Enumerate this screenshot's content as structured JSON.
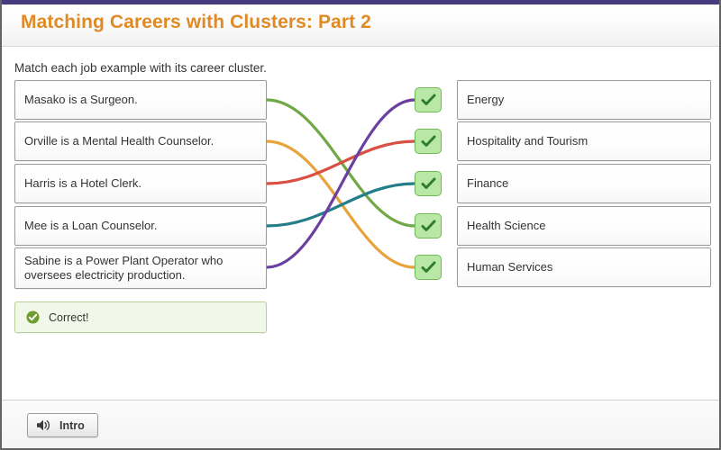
{
  "header": {
    "title": "Matching Careers with Clusters: Part 2",
    "title_color": "#e08a26",
    "accent_bar_color": "#473a7e"
  },
  "instruction": "Match each job example with its career cluster.",
  "prompts": [
    {
      "label": "Masako is a Surgeon.",
      "line_color": "#70a845"
    },
    {
      "label": "Orville is a Mental Health Counselor.",
      "line_color": "#e8a33d"
    },
    {
      "label": "Harris is a Hotel Clerk.",
      "line_color": "#d94f42"
    },
    {
      "label": "Mee is a Loan Counselor.",
      "line_color": "#247d8b"
    },
    {
      "label": "Sabine is a Power Plant Operator who oversees electricity production.",
      "line_color": "#6b3fa0"
    }
  ],
  "targets": [
    {
      "label": "Energy"
    },
    {
      "label": "Hospitality and Tourism"
    },
    {
      "label": "Finance"
    },
    {
      "label": "Health Science"
    },
    {
      "label": "Human Services"
    }
  ],
  "check_marks": [
    {
      "state": "correct"
    },
    {
      "state": "correct"
    },
    {
      "state": "correct"
    },
    {
      "state": "correct"
    },
    {
      "state": "correct"
    }
  ],
  "connections": [
    {
      "from": "Masako is a Surgeon.",
      "to": "Health Science",
      "color": "#70a845"
    },
    {
      "from": "Orville is a Mental Health Counselor.",
      "to": "Human Services",
      "color": "#e8a33d"
    },
    {
      "from": "Harris is a Hotel Clerk.",
      "to": "Hospitality and Tourism",
      "color": "#d94f42"
    },
    {
      "from": "Mee is a Loan Counselor.",
      "to": "Finance",
      "color": "#247d8b"
    },
    {
      "from": "Sabine is a Power Plant Operator who oversees electricity production.",
      "to": "Energy",
      "color": "#6b3fa0"
    }
  ],
  "feedback": {
    "text": "Correct!",
    "icon": "check-circle-icon",
    "background": "#f2f8e9",
    "border": "#b9cf99",
    "icon_color": "#6e9c31"
  },
  "footer": {
    "intro_button_label": "Intro",
    "intro_button_icon": "speaker-icon"
  }
}
